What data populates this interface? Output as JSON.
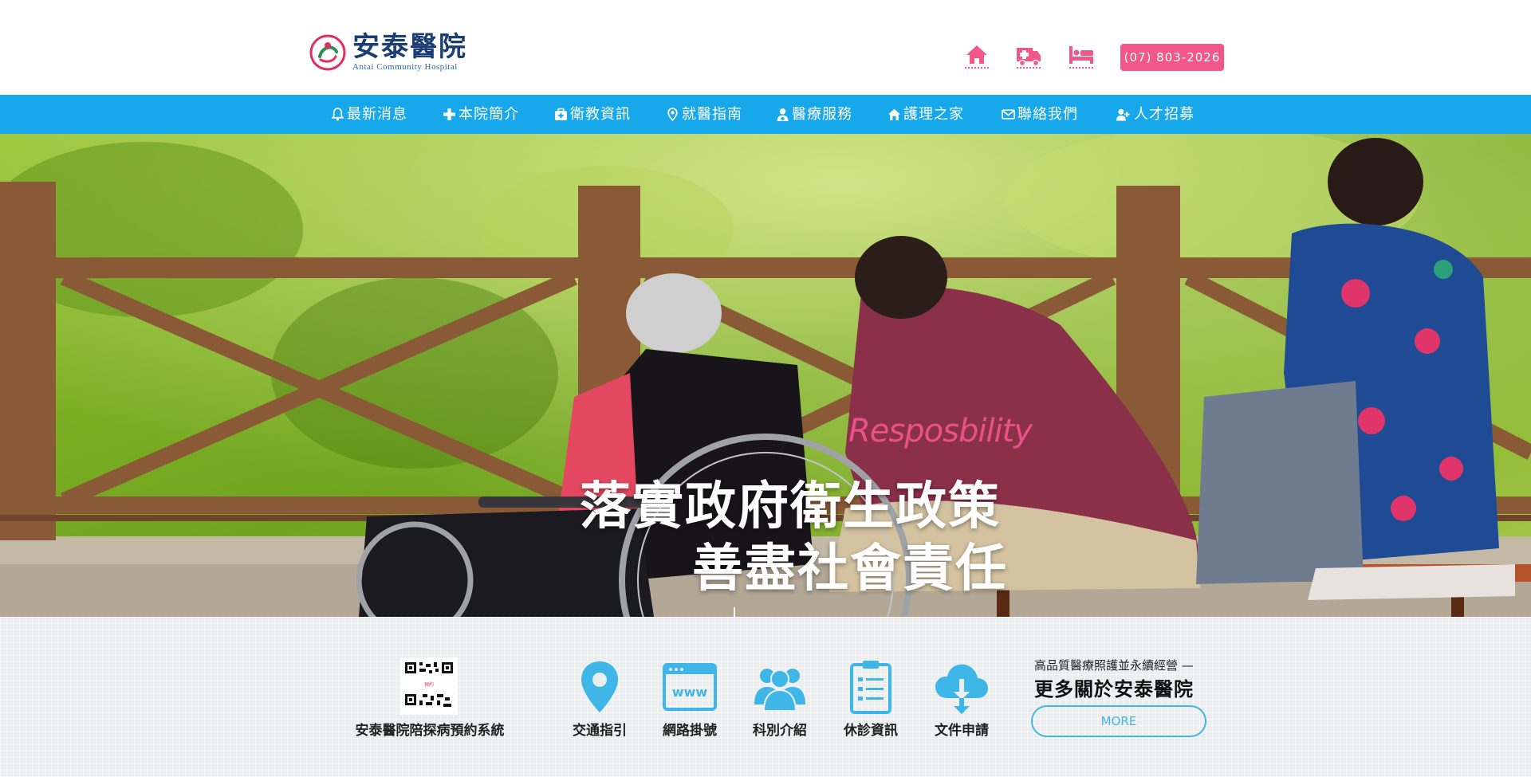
{
  "header": {
    "logo_cn": "安泰醫院",
    "logo_en": "Antai Community Hospital",
    "phone": "(07) 803-2026",
    "icons": [
      "home-icon",
      "ambulance-icon",
      "bed-icon"
    ]
  },
  "nav": {
    "items": [
      {
        "label": "最新消息",
        "icon": "bell-icon"
      },
      {
        "label": "本院簡介",
        "icon": "plus-icon"
      },
      {
        "label": "衛教資訊",
        "icon": "medkit-icon"
      },
      {
        "label": "就醫指南",
        "icon": "map-pin-icon"
      },
      {
        "label": "醫療服務",
        "icon": "doctor-icon"
      },
      {
        "label": "護理之家",
        "icon": "home-icon"
      },
      {
        "label": "聯絡我們",
        "icon": "envelope-icon"
      },
      {
        "label": "人才招募",
        "icon": "user-plus-icon"
      }
    ]
  },
  "hero": {
    "subtitle": "Resposbility",
    "line1": "落實政府衛生政策",
    "line2": "善盡社會責任"
  },
  "bottom": {
    "qr_label": "安泰醫院陪探病預約系統",
    "services": [
      {
        "label": "交通指引",
        "icon": "map-pin-icon"
      },
      {
        "label": "網路掛號",
        "icon": "www-icon"
      },
      {
        "label": "科別介紹",
        "icon": "users-icon"
      },
      {
        "label": "休診資訊",
        "icon": "clipboard-icon"
      },
      {
        "label": "文件申請",
        "icon": "cloud-download-icon"
      }
    ],
    "more_small": "高品質醫療照護並永續經營 —",
    "more_title": "更多關於安泰醫院",
    "more_button": "MORE"
  },
  "colors": {
    "nav_bg": "#17a8ec",
    "accent_pink": "#f2578a",
    "icon_blue": "#3fb6e8",
    "brand_navy": "#1c3d73"
  }
}
